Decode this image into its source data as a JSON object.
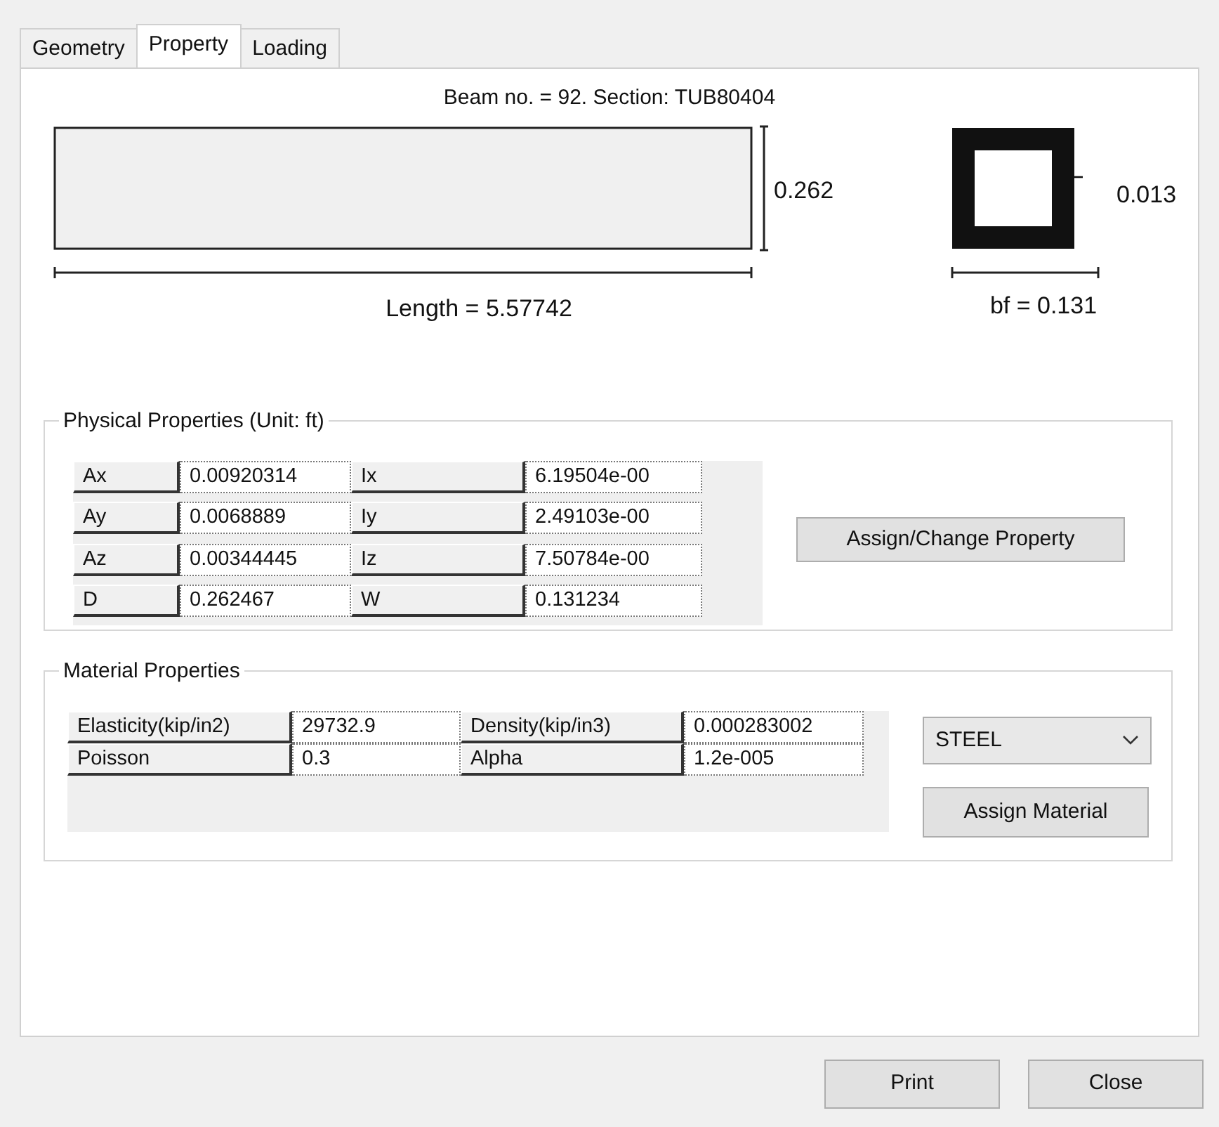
{
  "tabs": [
    {
      "label": "Geometry",
      "selected": false
    },
    {
      "label": "Property",
      "selected": true
    },
    {
      "label": "Loading",
      "selected": false
    }
  ],
  "heading": "Beam no. = 92. Section: TUB80404",
  "drawing": {
    "depth_label": "0.262",
    "length_label": "Length = 5.57742",
    "thickness_label": "0.013",
    "width_label": "bf = 0.131"
  },
  "physical_properties": {
    "title": "Physical Properties (Unit: ft)",
    "rows": [
      {
        "name": "Ax",
        "value": "0.00920314",
        "name_2": "Ix",
        "value_2": "6.19504e-00"
      },
      {
        "name": "Ay",
        "value": "0.0068889",
        "name_2": "Iy",
        "value_2": "2.49103e-00"
      },
      {
        "name": "Az",
        "value": "0.00344445",
        "name_2": "Iz",
        "value_2": "7.50784e-00"
      },
      {
        "name": "D",
        "value": "0.262467",
        "name_2": "W",
        "value_2": "0.131234"
      }
    ],
    "button": "Assign/Change Property"
  },
  "material_properties": {
    "title": "Material Properties",
    "rows": [
      {
        "name": "Elasticity(kip/in2)",
        "value": "29732.9",
        "name_2": "Density(kip/in3)",
        "value_2": "0.000283002"
      },
      {
        "name": "Poisson",
        "value": "0.3",
        "name_2": "Alpha",
        "value_2": "1.2e-005"
      }
    ],
    "material": "STEEL",
    "button": "Assign Material"
  },
  "buttons": [
    "Print",
    "Close"
  ]
}
